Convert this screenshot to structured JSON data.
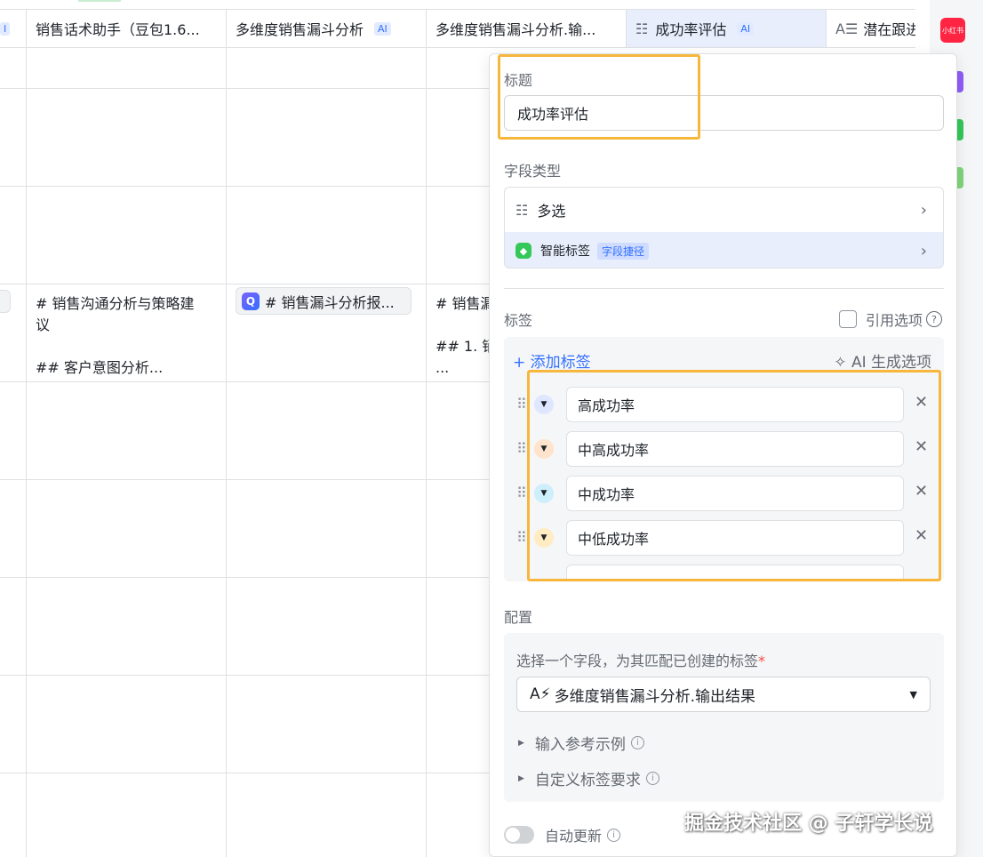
{
  "table": {
    "headers": [
      {
        "label": "I",
        "ai": ""
      },
      {
        "label": "销售话术助手（豆包1.6...",
        "ai": ""
      },
      {
        "label": "多维度销售漏斗分析",
        "ai": "AI"
      },
      {
        "label": "多维度销售漏斗分析.输...",
        "ai": ""
      },
      {
        "label": "成功率评估",
        "ai": "AI"
      },
      {
        "label": "潜在跟进",
        "ai": ""
      }
    ],
    "row4_col1": "# 销售沟通分析与策略建\n议\n\n## 客户意图分析...",
    "row4_col2_chip": "# 销售漏斗分析报...",
    "row4_col3": "# 销售漏\n\n## 1. 销\n..."
  },
  "rail": {
    "badge": "小红书"
  },
  "panel": {
    "title_label": "标题",
    "title_value": "成功率评估",
    "field_type_label": "字段类型",
    "field_type_value": "多选",
    "smart_tag": "智能标签",
    "smart_tag_badge": "字段捷径",
    "tags_label": "标签",
    "ref_option": "引用选项",
    "add_tag": "+ 添加标签",
    "ai_generate": "✧ AI 生成选项",
    "tags": [
      {
        "label": "高成功率",
        "color": "#dfe6ff"
      },
      {
        "label": "中高成功率",
        "color": "#ffe3cc"
      },
      {
        "label": "中成功率",
        "color": "#cdeefb"
      },
      {
        "label": "中低成功率",
        "color": "#ffecc2"
      }
    ],
    "config_label": "配置",
    "config_prompt": "选择一个字段，为其匹配已创建的标签",
    "config_required": "*",
    "config_select": "多维度销售漏斗分析.输出结果",
    "input_examples": "输入参考示例",
    "custom_requirements": "自定义标签要求",
    "auto_update": "自动更新"
  },
  "watermark": "掘金技术社区 @ 子轩学长说"
}
